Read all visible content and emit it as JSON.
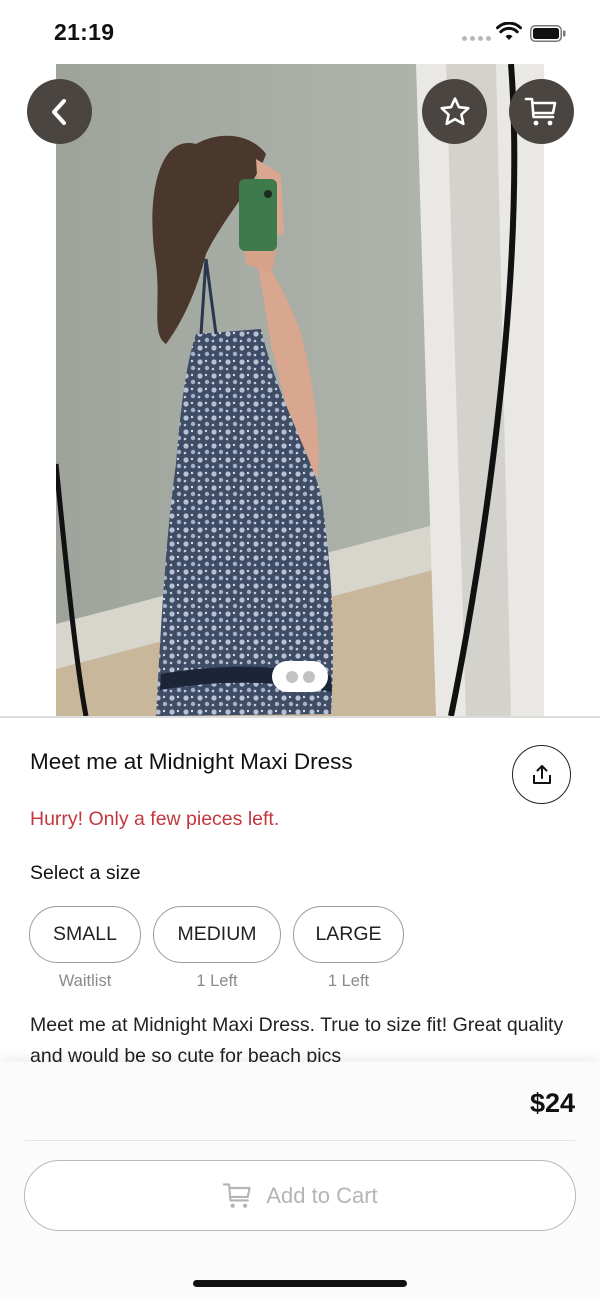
{
  "status_bar": {
    "time": "21:19"
  },
  "header": {
    "back_icon": "chevron-left-icon",
    "favorite_icon": "star-outline-icon",
    "cart_icon": "cart-icon"
  },
  "gallery": {
    "page_count": 2,
    "current_page": 1
  },
  "product": {
    "title": "Meet me at Midnight Maxi Dress",
    "stock_warning": "Hurry! Only a few pieces left.",
    "size_label": "Select a size",
    "sizes": [
      {
        "label": "SMALL",
        "availability": "Waitlist"
      },
      {
        "label": "MEDIUM",
        "availability": "1 Left"
      },
      {
        "label": "LARGE",
        "availability": "1 Left"
      }
    ],
    "description": "Meet me at Midnight Maxi Dress. True to size fit! Great quality and would be so cute for beach pics"
  },
  "purchase": {
    "price": "$24",
    "add_to_cart_label": "Add to Cart"
  },
  "colors": {
    "warning": "#c4373e",
    "overlay_button": "#4a4541",
    "disabled": "#b5b5b5"
  }
}
